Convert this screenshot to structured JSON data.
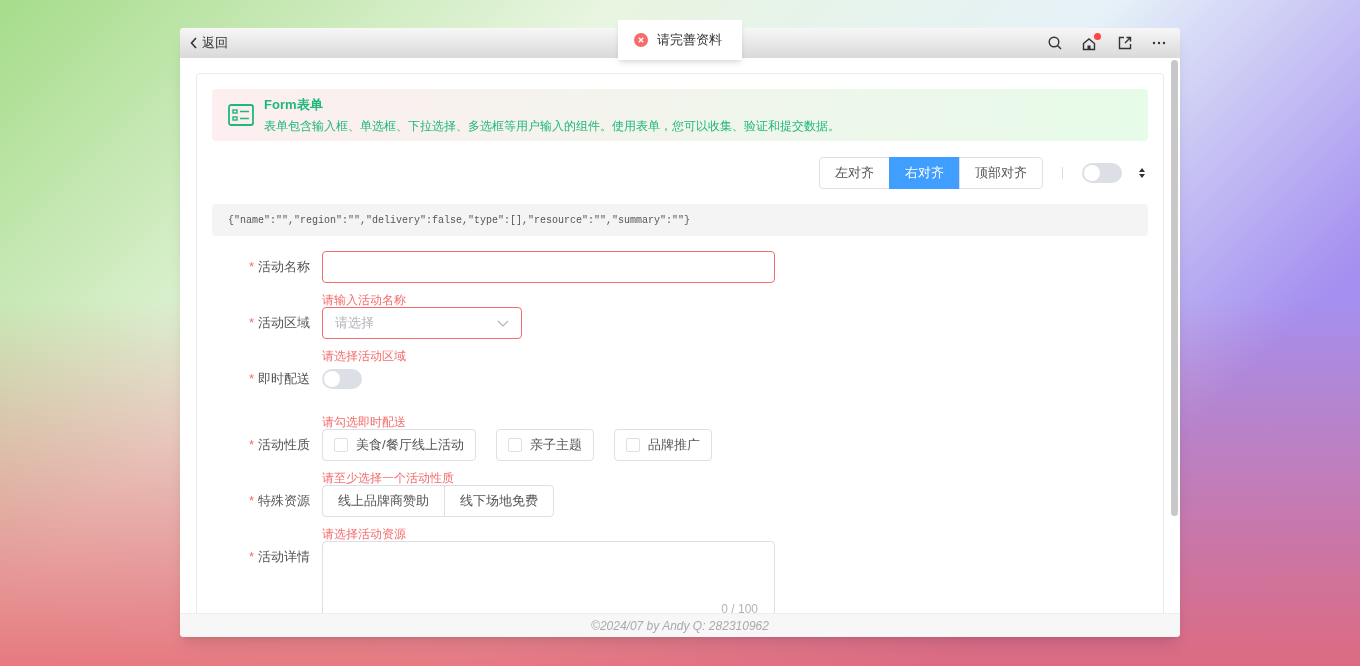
{
  "toast": {
    "text": "请完善资料"
  },
  "header": {
    "back_label": "返回",
    "notification_dot": true
  },
  "banner": {
    "title": "Form表单",
    "description": "表单包含输入框、单选框、下拉选择、多选框等用户输入的组件。使用表单，您可以收集、验证和提交数据。"
  },
  "align_options": [
    {
      "label": "左对齐",
      "selected": false
    },
    {
      "label": "右对齐",
      "selected": true
    },
    {
      "label": "顶部对齐",
      "selected": false
    }
  ],
  "size_switch": {
    "on": false
  },
  "json_preview": "{\"name\":\"\",\"region\":\"\",\"delivery\":false,\"type\":[],\"resource\":\"\",\"summary\":\"\"}",
  "form_items": [
    {
      "kind": "input",
      "label": "活动名称",
      "required_mark": "*",
      "error": "请输入活动名称"
    },
    {
      "kind": "select",
      "label": "活动区域",
      "required_mark": "*",
      "placeholder": "请选择",
      "error": "请选择活动区域"
    },
    {
      "kind": "switch",
      "label": "即时配送",
      "required_mark": "*",
      "on": false,
      "error": "请勾选即时配送"
    },
    {
      "kind": "checkboxes",
      "label": "活动性质",
      "required_mark": "*",
      "options": [
        {
          "label": "美食/餐厅线上活动",
          "checked": false
        },
        {
          "label": "亲子主题",
          "checked": false
        },
        {
          "label": "品牌推广",
          "checked": false
        }
      ],
      "error": "请至少选择一个活动性质"
    },
    {
      "kind": "buttons",
      "label": "特殊资源",
      "required_mark": "*",
      "options": [
        {
          "label": "线上品牌商赞助",
          "selected": false
        },
        {
          "label": "线下场地免费",
          "selected": false
        }
      ],
      "error": "请选择活动资源"
    },
    {
      "kind": "textarea",
      "label": "活动详情",
      "required_mark": "*",
      "counter": "0 / 100"
    }
  ],
  "footer": "©2024/07 by Andy Q: 282310962"
}
